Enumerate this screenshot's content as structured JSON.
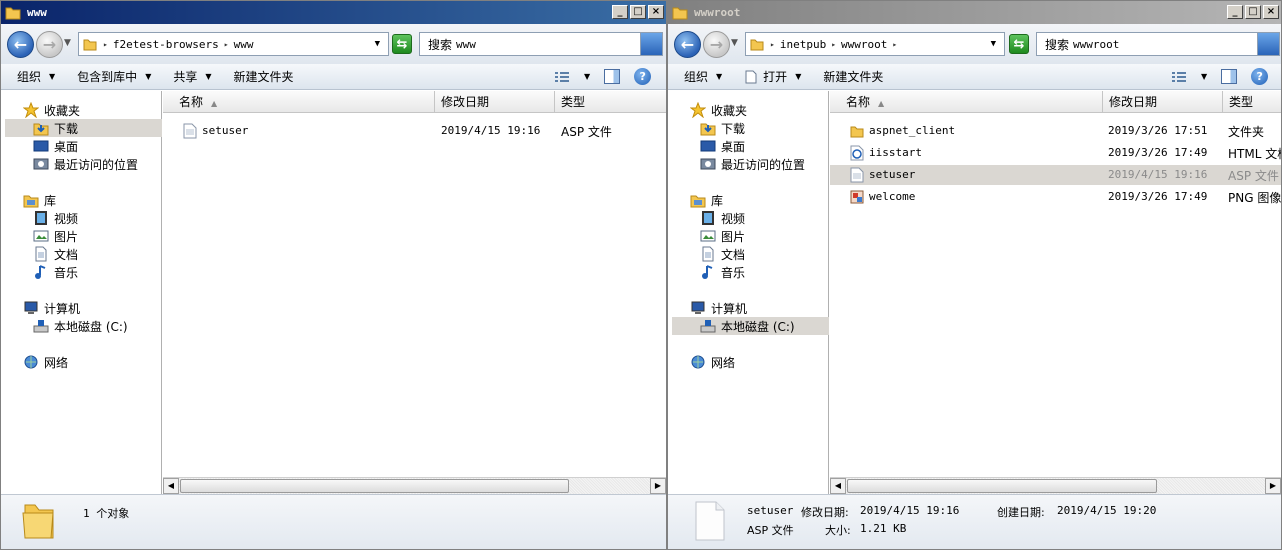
{
  "left": {
    "title": "www",
    "address": [
      "f2etest-browsers",
      "www"
    ],
    "search_label": "搜索",
    "search_value": "www",
    "commands": [
      "组织",
      "包含到库中",
      "共享",
      "新建文件夹"
    ],
    "nav": {
      "favorites": "收藏夹",
      "downloads": "下载",
      "desktop": "桌面",
      "recent": "最近访问的位置",
      "libraries": "库",
      "videos": "视频",
      "pictures": "图片",
      "documents": "文档",
      "music": "音乐",
      "computer": "计算机",
      "local_disk": "本地磁盘 (C:)",
      "network": "网络"
    },
    "columns": [
      "名称",
      "修改日期",
      "类型"
    ],
    "files": [
      {
        "name": "setuser",
        "date": "2019/4/15 19:16",
        "type": "ASP 文件"
      }
    ],
    "status": "1 个对象"
  },
  "right": {
    "title": "wwwroot",
    "address": [
      "inetpub",
      "wwwroot"
    ],
    "search_label": "搜索",
    "search_value": "wwwroot",
    "commands": [
      "组织",
      "打开",
      "新建文件夹"
    ],
    "nav": {
      "favorites": "收藏夹",
      "downloads": "下载",
      "desktop": "桌面",
      "recent": "最近访问的位置",
      "libraries": "库",
      "videos": "视频",
      "pictures": "图片",
      "documents": "文档",
      "music": "音乐",
      "computer": "计算机",
      "local_disk": "本地磁盘 (C:)",
      "network": "网络"
    },
    "columns": [
      "名称",
      "修改日期",
      "类型"
    ],
    "files": [
      {
        "name": "aspnet_client",
        "date": "2019/3/26 17:51",
        "type": "文件夹"
      },
      {
        "name": "iisstart",
        "date": "2019/3/26 17:49",
        "type": "HTML 文档"
      },
      {
        "name": "setuser",
        "date": "2019/4/15 19:16",
        "type": "ASP 文件"
      },
      {
        "name": "welcome",
        "date": "2019/3/26 17:49",
        "type": "PNG 图像"
      }
    ],
    "details": {
      "name": "setuser",
      "modified_label": "修改日期:",
      "modified": "2019/4/15 19:16",
      "created_label": "创建日期:",
      "created": "2019/4/15 19:20",
      "type": "ASP 文件",
      "size_label": "大小:",
      "size": "1.21 KB"
    }
  },
  "colors": {
    "active_title": "#0a246a",
    "inactive_title": "#808080",
    "selection": "#dad7d2"
  }
}
